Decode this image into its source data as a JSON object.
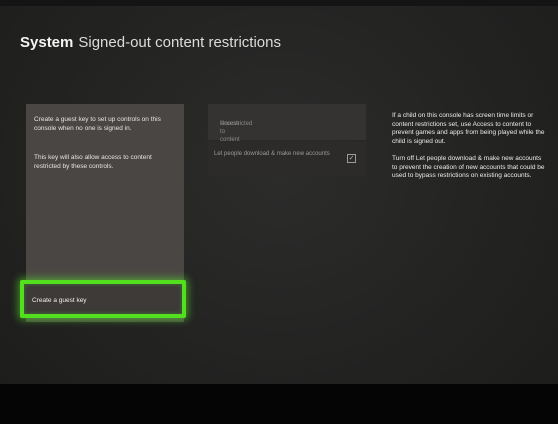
{
  "header": {
    "section": "System",
    "title": "Signed-out content restrictions"
  },
  "left_panel": {
    "description_1": "Create a guest key to set up controls on this console when no one is signed in.",
    "description_2": "This key will also allow access to content restricted by these controls.",
    "create_guest_key_label": "Create a guest key"
  },
  "settings": {
    "access_to_content_label": "Access to content",
    "access_to_content_value": "Unrestricted",
    "let_people_download_label": "Let people download & make new accounts",
    "let_people_download_checked": true
  },
  "help_text": {
    "paragraph_1": "If a child on this console has screen time limits or content restrictions set, use Access to content to prevent games and apps from being played while the child is signed out.",
    "paragraph_2": "Turn off Let people download & make new accounts to prevent the creation of new accounts that could be used to bypass restrictions on existing accounts."
  },
  "colors": {
    "focus_highlight": "#52e01e",
    "panel_background": "#4a4644",
    "screen_background": "#232322"
  }
}
